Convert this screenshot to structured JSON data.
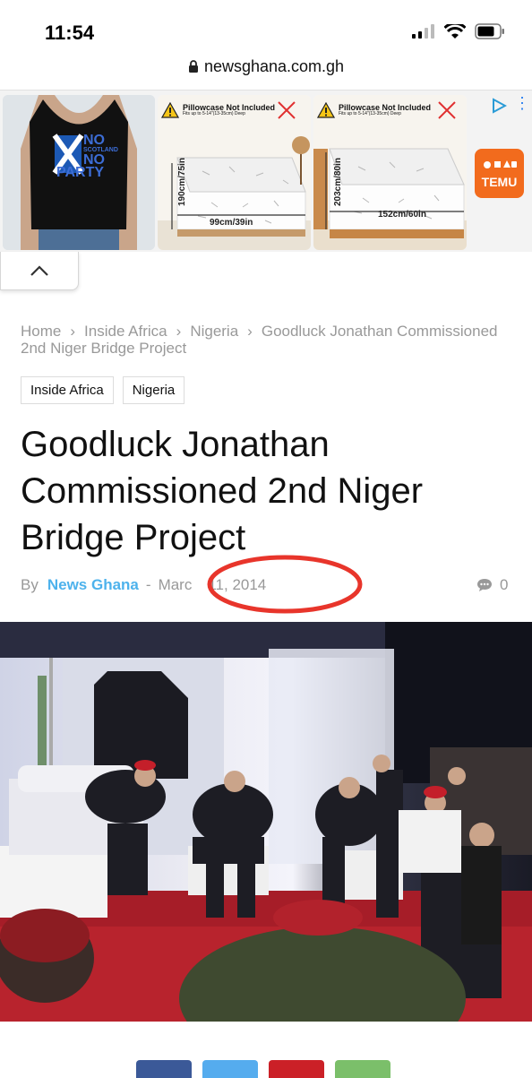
{
  "status_bar": {
    "time": "11:54",
    "icons": [
      "signal-icon",
      "wifi-icon",
      "battery-icon"
    ]
  },
  "url_bar": {
    "domain": "newsghana.com.gh"
  },
  "ad": {
    "shirt_text": [
      "NO",
      "SCOTLAND",
      "NO",
      "PARTY"
    ],
    "tile1": {
      "warning": "Pillowcase Not Included",
      "sub": "Fits up to 5-14\"(13-35cm) Deep",
      "height": "190cm/75in",
      "width": "99cm/39in"
    },
    "tile2": {
      "warning": "Pillowcase Not Included",
      "sub": "Fits up to 5-14\"(13-35cm) Deep",
      "height": "203cm/80in",
      "width": "152cm/60in"
    },
    "brand": "TEMU"
  },
  "breadcrumb": {
    "home": "Home",
    "section": "Inside Africa",
    "country": "Nigeria",
    "current": "Goodluck Jonathan Commissioned 2nd Niger Bridge Project"
  },
  "tags": [
    "Inside Africa",
    "Nigeria"
  ],
  "article": {
    "title": "Goodluck Jonathan Commissioned 2nd Niger Bridge Project",
    "by": "By",
    "author": "News Ghana",
    "date_part1": "Marc",
    "date_part2": "11, 2014",
    "comments": "0"
  },
  "colors": {
    "accent": "#4db2ec",
    "annotation": "#e8352b",
    "share": [
      "#3b5998",
      "#55acee",
      "#cb2027",
      "#7bbf6a"
    ]
  }
}
